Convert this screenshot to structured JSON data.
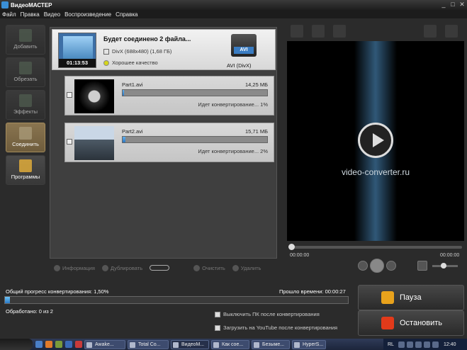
{
  "window": {
    "title": "ВидеоМАСТЕР"
  },
  "menu": [
    "Файл",
    "Правка",
    "Видео",
    "Воспроизведение",
    "Справка"
  ],
  "sidebar": [
    {
      "label": "Добавить",
      "state": "disabled"
    },
    {
      "label": "Обрезать",
      "state": "disabled"
    },
    {
      "label": "Эффекты",
      "state": "disabled"
    },
    {
      "label": "Соединить",
      "state": "active"
    },
    {
      "label": "Программы",
      "state": "normal"
    }
  ],
  "merge": {
    "duration": "01:13:53",
    "title": "Будет соединено 2 файла...",
    "info": "DivX (688x480) (1,68 ГБ)",
    "quality": "Хорошее качество",
    "format_tag": "AVI",
    "format_label": "AVI (DivX)"
  },
  "files": [
    {
      "name": "Part1.avi",
      "size": "14,25 МБ",
      "status": "Идет конвертирование... 1%",
      "progress": 0.01
    },
    {
      "name": "Part2.avi",
      "size": "15,71 МБ",
      "status": "Идет конвертирование... 2%",
      "progress": 0.02
    }
  ],
  "center_tools": {
    "info": "Информация",
    "duplicate": "Дублировать",
    "clear": "Очистить",
    "remove": "Удалить"
  },
  "preview": {
    "brand": "video-converter.ru",
    "time_current": "00:00:00",
    "time_total": "00:00:00"
  },
  "status": {
    "progress_label": "Общий прогресс конвертирования: 1,50%",
    "progress": 0.015,
    "elapsed": "Прошло времени: 00:00:27",
    "processed": "Обработано: 0 из 2",
    "opt_shutdown": "Выключить ПК после конвертирования",
    "opt_youtube": "Загрузить на YouTube после конвертирования"
  },
  "buttons": {
    "pause": "Пауза",
    "stop": "Остановить"
  },
  "taskbar": {
    "tasks": [
      "Awake...",
      "Total Co...",
      "ВидеоМ...",
      "Как сое...",
      "Безыме...",
      "HyperS..."
    ],
    "lang": "RL",
    "clock": "12:40"
  },
  "colors": {
    "accent": "#2d76c0",
    "active_tab": "#8a7550",
    "pause_icon": "#e8a21c",
    "stop_icon": "#e23a1a"
  }
}
